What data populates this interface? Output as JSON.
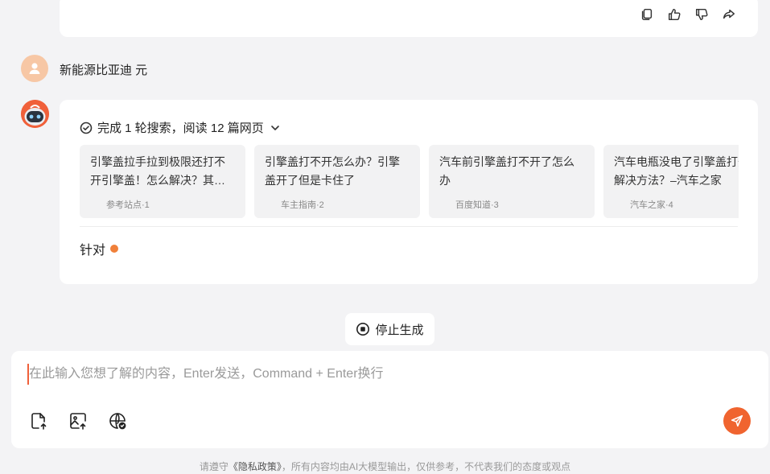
{
  "top_card": {
    "actions": [
      {
        "name": "copy-icon"
      },
      {
        "name": "thumbs-up-icon"
      },
      {
        "name": "thumbs-down-icon"
      },
      {
        "name": "share-icon"
      }
    ]
  },
  "user_message": {
    "text": "新能源比亚迪 元"
  },
  "bot_message": {
    "search_summary": "完成 1 轮搜索，阅读 12 篇网页",
    "references": [
      {
        "title": "引擎盖拉手拉到极限还打不开引擎盖！怎么解决？其…",
        "source": "参考站点·1"
      },
      {
        "title": "引擎盖打不开怎么办？引擎盖开了但是卡住了",
        "source": "车主指南·2"
      },
      {
        "title": "汽车前引擎盖打不开了怎么办",
        "source": "百度知道·3"
      },
      {
        "title": "汽车电瓶没电了引擎盖打开解决方法？–汽车之家",
        "source": "汽车之家·4"
      }
    ],
    "answer_text": "针对"
  },
  "stop_button": {
    "label": "停止生成"
  },
  "composer": {
    "placeholder": "在此输入您想了解的内容，Enter发送，Command + Enter换行",
    "tools": [
      "upload-file-icon",
      "upload-image-icon",
      "web-search-icon"
    ]
  },
  "footer": {
    "prefix": "请遵守",
    "policy_link": "《隐私政策》",
    "suffix": "，所有内容均由AI大模型输出，仅供参考，不代表我们的态度或观点"
  },
  "colors": {
    "accent": "#f0642f",
    "background": "#f3f3f5"
  }
}
